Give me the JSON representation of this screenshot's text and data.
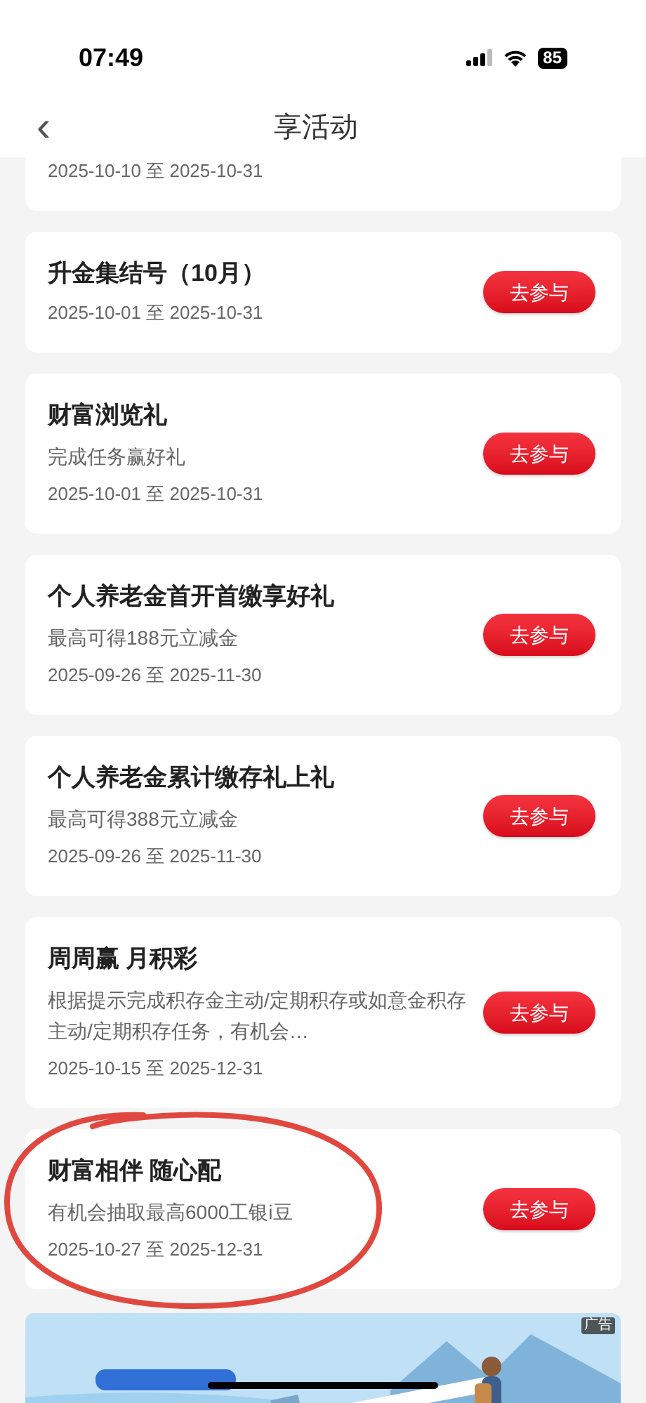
{
  "status_bar": {
    "time": "07:49",
    "battery": "85"
  },
  "nav": {
    "back": "‹",
    "title": "享活动"
  },
  "cards": [
    {
      "dates": "2025-10-10 至 2025-10-31",
      "circled": false
    },
    {
      "title": "升金集结号（10月）",
      "dates": "2025-10-01 至 2025-10-31",
      "button": "去参与",
      "circled": false
    },
    {
      "title": "财富浏览礼",
      "description": "完成任务赢好礼",
      "dates": "2025-10-01 至 2025-10-31",
      "button": "去参与",
      "circled": false
    },
    {
      "title": "个人养老金首开首缴享好礼",
      "description": "最高可得188元立减金",
      "dates": "2025-09-26 至 2025-11-30",
      "button": "去参与",
      "circled": false
    },
    {
      "title": "个人养老金累计缴存礼上礼",
      "description": "最高可得388元立减金",
      "dates": "2025-09-26 至 2025-11-30",
      "button": "去参与",
      "circled": false
    },
    {
      "title": "周周赢 月积彩",
      "description": "根据提示完成积存金主动/定期积存或如意金积存主动/定期积存任务，有机会…",
      "dates": "2025-10-15 至 2025-12-31",
      "button": "去参与",
      "circled": false
    },
    {
      "title": "财富相伴 随心配",
      "description": "有机会抽取最高6000工银i豆",
      "dates": "2025-10-27 至 2025-12-31",
      "button": "去参与",
      "circled": true
    }
  ],
  "banner": {
    "kind": "picture",
    "ad_label": "广告"
  }
}
